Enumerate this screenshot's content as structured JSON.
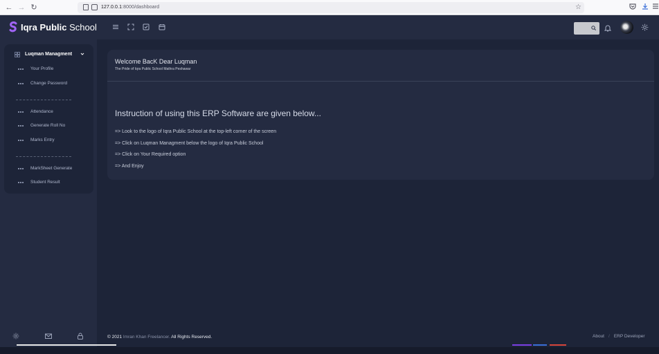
{
  "browser": {
    "url_host": "127.0.0.1",
    "url_rest": ":8000/dashboard"
  },
  "header": {
    "brand_bold": "Iqra Public",
    "brand_light": "School",
    "logo_color": "#9b5cf6"
  },
  "sidebar": {
    "menu_title": "Luqman Managment",
    "groups": [
      [
        "Your Profile",
        "Change Password"
      ],
      [
        "Attendance",
        "Generate Roll No",
        "Marks Entry"
      ],
      [
        "MarkSheet Generate",
        "Student Result"
      ]
    ]
  },
  "content": {
    "welcome": "Welcome BacK Dear Luqman",
    "tagline": "The Pride of Iqra Public School Mathra Peshawar",
    "instruction_title": "Instruction of using this ERP Software are given below...",
    "instructions": [
      "=> Look to the logo of Iqra Public School at the top-left corner of the screen",
      "=> Click on Luqman Managment below the logo of Iqra Public School",
      "=> Click on Your Required option",
      "=> And Enjoy"
    ]
  },
  "footer": {
    "copyright_prefix": "© 2021",
    "credit": "Imran Khan Freelancer.",
    "rights": "All Rights Reserved.",
    "about": "About",
    "separator": "/",
    "developer": "ERP Developer"
  },
  "icons": {
    "header": [
      "menu-icon",
      "fullscreen-icon",
      "task-icon",
      "calendar-icon",
      "search-icon",
      "bell-icon",
      "avatar",
      "gear-icon"
    ],
    "sidebar_bottom": [
      "gear-icon",
      "mail-icon",
      "lock-icon"
    ]
  }
}
